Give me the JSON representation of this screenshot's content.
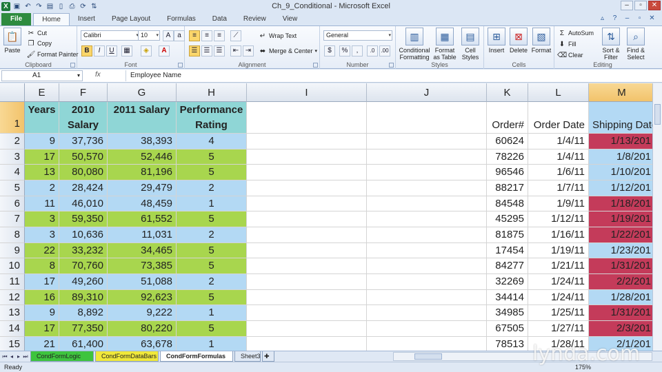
{
  "window": {
    "title": "Ch_9_Conditional - Microsoft Excel"
  },
  "qat": [
    {
      "icon": "excel-logo-icon",
      "glyph": "X"
    },
    {
      "icon": "save-icon",
      "glyph": "▣"
    },
    {
      "icon": "undo-icon",
      "glyph": "↶"
    },
    {
      "icon": "redo-icon",
      "glyph": "↷"
    },
    {
      "icon": "open-icon",
      "glyph": "▤"
    },
    {
      "icon": "new-icon",
      "glyph": "▯"
    },
    {
      "icon": "print-icon",
      "glyph": "⎙"
    },
    {
      "icon": "refresh-icon",
      "glyph": "⟳"
    },
    {
      "icon": "sort-icon",
      "glyph": "⇅"
    }
  ],
  "tabs": [
    "File",
    "Home",
    "Insert",
    "Page Layout",
    "Formulas",
    "Data",
    "Review",
    "View"
  ],
  "active_tab": "Home",
  "ribbon": {
    "clipboard": {
      "label": "Clipboard",
      "paste": "Paste",
      "cut": "Cut",
      "copy": "Copy",
      "format_painter": "Format Painter"
    },
    "font": {
      "label": "Font",
      "font_name": "Calibri",
      "font_size": "10",
      "bold": "B",
      "italic": "I",
      "underline": "U"
    },
    "alignment": {
      "label": "Alignment",
      "wrap_text": "Wrap Text",
      "merge_center": "Merge & Center"
    },
    "number": {
      "label": "Number",
      "format": "General",
      "currency": "$",
      "percent": "%",
      "comma": ","
    },
    "styles": {
      "label": "Styles",
      "conditional_formatting": "Conditional Formatting",
      "format_as_table": "Format as Table",
      "cell_styles": "Cell Styles"
    },
    "cells": {
      "label": "Cells",
      "insert": "Insert",
      "delete": "Delete",
      "format": "Format"
    },
    "editing": {
      "label": "Editing",
      "autosum": "AutoSum",
      "fill": "Fill",
      "clear": "Clear",
      "sort_filter": "Sort & Filter",
      "find_select": "Find & Select"
    }
  },
  "formula_bar": {
    "name_box": "A1",
    "fx": "fx",
    "value": "Employee Name"
  },
  "columns": [
    "E",
    "F",
    "G",
    "H",
    "I",
    "J",
    "K",
    "L",
    "M"
  ],
  "header_row": {
    "E": "Years",
    "F": "2010 Salary",
    "G": "2011 Salary",
    "H": "Performance Rating",
    "K": "Order#",
    "L": "Order Date",
    "M": "Shipping Date"
  },
  "rows": [
    {
      "n": "2",
      "e": "9",
      "f": "37,736",
      "g": "38,393",
      "h": "4",
      "k": "60624",
      "l": "1/4/11",
      "m": "1/13/201",
      "hc": "blue",
      "mc": "red"
    },
    {
      "n": "3",
      "e": "17",
      "f": "50,570",
      "g": "52,446",
      "h": "5",
      "k": "78226",
      "l": "1/4/11",
      "m": "1/8/201",
      "hc": "green",
      "mc": "blue"
    },
    {
      "n": "4",
      "e": "13",
      "f": "80,080",
      "g": "81,196",
      "h": "5",
      "k": "96546",
      "l": "1/6/11",
      "m": "1/10/201",
      "hc": "green",
      "mc": "blue"
    },
    {
      "n": "5",
      "e": "2",
      "f": "28,424",
      "g": "29,479",
      "h": "2",
      "k": "88217",
      "l": "1/7/11",
      "m": "1/12/201",
      "hc": "blue",
      "mc": "blue"
    },
    {
      "n": "6",
      "e": "11",
      "f": "46,010",
      "g": "48,459",
      "h": "1",
      "k": "84548",
      "l": "1/9/11",
      "m": "1/18/201",
      "hc": "blue",
      "mc": "red"
    },
    {
      "n": "7",
      "e": "3",
      "f": "59,350",
      "g": "61,552",
      "h": "5",
      "k": "45295",
      "l": "1/12/11",
      "m": "1/19/201",
      "hc": "green",
      "mc": "red"
    },
    {
      "n": "8",
      "e": "3",
      "f": "10,636",
      "g": "11,031",
      "h": "2",
      "k": "81875",
      "l": "1/16/11",
      "m": "1/22/201",
      "hc": "blue",
      "mc": "red"
    },
    {
      "n": "9",
      "e": "22",
      "f": "33,232",
      "g": "34,465",
      "h": "5",
      "k": "17454",
      "l": "1/19/11",
      "m": "1/23/201",
      "hc": "green",
      "mc": "blue"
    },
    {
      "n": "10",
      "e": "8",
      "f": "70,760",
      "g": "73,385",
      "h": "5",
      "k": "84277",
      "l": "1/21/11",
      "m": "1/31/201",
      "hc": "green",
      "mc": "red"
    },
    {
      "n": "11",
      "e": "17",
      "f": "49,260",
      "g": "51,088",
      "h": "2",
      "k": "32269",
      "l": "1/24/11",
      "m": "2/2/201",
      "hc": "blue",
      "mc": "red"
    },
    {
      "n": "12",
      "e": "16",
      "f": "89,310",
      "g": "92,623",
      "h": "5",
      "k": "34414",
      "l": "1/24/11",
      "m": "1/28/201",
      "hc": "green",
      "mc": "blue"
    },
    {
      "n": "13",
      "e": "9",
      "f": "8,892",
      "g": "9,222",
      "h": "1",
      "k": "34985",
      "l": "1/25/11",
      "m": "1/31/201",
      "hc": "blue",
      "mc": "red"
    },
    {
      "n": "14",
      "e": "17",
      "f": "77,350",
      "g": "80,220",
      "h": "5",
      "k": "67505",
      "l": "1/27/11",
      "m": "2/3/201",
      "hc": "green",
      "mc": "red"
    },
    {
      "n": "15",
      "e": "21",
      "f": "61,400",
      "g": "63,678",
      "h": "1",
      "k": "78513",
      "l": "1/28/11",
      "m": "2/1/201",
      "hc": "blue",
      "mc": "blue"
    }
  ],
  "colors": {
    "blue": "#b3d9f4",
    "green": "#a8d64e",
    "red": "#c43b5a",
    "header": "#8fd6d6",
    "selected": "#f2c36b"
  },
  "sheets": [
    {
      "name": "CondFormLogic",
      "color": "#3ec43e"
    },
    {
      "name": "CondFormDataBars",
      "color": "#f0e83a"
    },
    {
      "name": "CondFormFormulas",
      "color": "#ffffff"
    },
    {
      "name": "Sheet3",
      "color": "#dfe8f4"
    }
  ],
  "status": {
    "mode": "Ready",
    "zoom": "175%"
  },
  "watermark": "lynda.com"
}
